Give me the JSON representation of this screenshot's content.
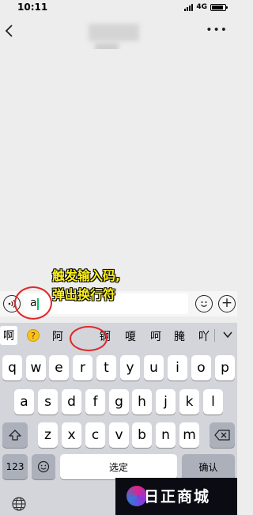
{
  "status_bar": {
    "time": "10:11",
    "network": "4G",
    "battery_level": 0.9
  },
  "caption": {
    "line1": "触发输入码,",
    "line2": "弹出换行符"
  },
  "input_bar": {
    "text": "a"
  },
  "candidates": {
    "first": "啊",
    "emoji": "thinking-face",
    "items": [
      "阿",
      "锕",
      "嗄",
      "呵",
      "腌",
      "吖"
    ]
  },
  "keyboard": {
    "row1": [
      "q",
      "w",
      "e",
      "r",
      "t",
      "y",
      "u",
      "i",
      "o",
      "p"
    ],
    "row2": [
      "a",
      "s",
      "d",
      "f",
      "g",
      "h",
      "j",
      "k",
      "l"
    ],
    "row3": [
      "z",
      "x",
      "c",
      "v",
      "b",
      "n",
      "m"
    ],
    "numbers_key": "123",
    "space_key": "选定",
    "confirm_key": "确认"
  },
  "watermark": {
    "text": "日正商城"
  },
  "colors": {
    "caption": "#fff31a",
    "annotation": "#e02828",
    "cursor": "#07c160"
  }
}
